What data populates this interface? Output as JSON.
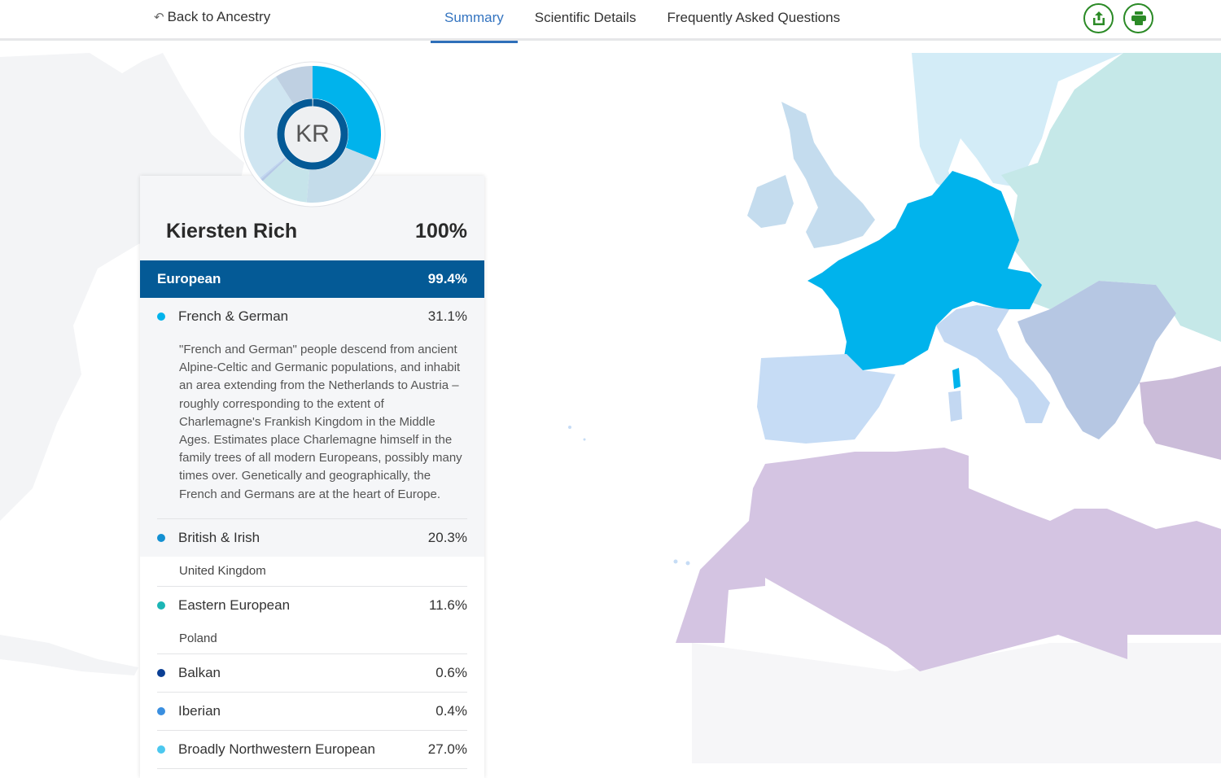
{
  "nav": {
    "back_label": "Back to Ancestry",
    "back_icon": "back-arrow-icon",
    "tabs": [
      {
        "label": "Summary",
        "active": true
      },
      {
        "label": "Scientific Details",
        "active": false
      },
      {
        "label": "Frequently Asked Questions",
        "active": false
      }
    ],
    "actions": [
      {
        "name": "share",
        "icon": "share-upload-icon"
      },
      {
        "name": "print",
        "icon": "printer-icon"
      }
    ],
    "accent_color": "#3474c0",
    "action_color": "#2b8a26"
  },
  "profile": {
    "initials": "KR",
    "name": "Kiersten Rich",
    "total": "100%"
  },
  "composition": {
    "group": {
      "label": "European",
      "percent": "99.4%",
      "color": "#045a96"
    },
    "populations": [
      {
        "label": "French & German",
        "percent": "31.1%",
        "color": "#00b3ec",
        "description": "\"French and German\" people descend from ancient Alpine-Celtic and Germanic populations, and inhabit an area extending from the Netherlands to Austria – roughly corresponding to the extent of Charlemagne's Frankish Kingdom in the Middle Ages. Estimates place Charlemagne himself in the family trees of all modern Europeans, possibly many times over. Genetically and geographically, the French and Germans are at the heart of Europe."
      },
      {
        "label": "British & Irish",
        "percent": "20.3%",
        "color": "#1390d2",
        "sublocation": "United Kingdom"
      },
      {
        "label": "Eastern European",
        "percent": "11.6%",
        "color": "#1bb5b5",
        "sublocation": "Poland"
      },
      {
        "label": "Balkan",
        "percent": "0.6%",
        "color": "#0b3f94"
      },
      {
        "label": "Iberian",
        "percent": "0.4%",
        "color": "#3a8fe0"
      },
      {
        "label": "Broadly Northwestern European",
        "percent": "27.0%",
        "color": "#4cc8ef"
      }
    ]
  },
  "donut_chart": {
    "segments": [
      {
        "label": "French & German",
        "value": 31.1,
        "color": "#00b3ec"
      },
      {
        "label": "British & Irish",
        "value": 20.3,
        "color": "#c4dcea"
      },
      {
        "label": "Eastern European",
        "value": 11.6,
        "color": "#c6e4ea"
      },
      {
        "label": "Balkan",
        "value": 0.6,
        "color": "#b5c8e6"
      },
      {
        "label": "Iberian",
        "value": 0.4,
        "color": "#c0d6f0"
      },
      {
        "label": "Broadly Northwestern European",
        "value": 27.0,
        "color": "#cfe5f1"
      },
      {
        "label": "Other",
        "value": 9.0,
        "color": "#bfd0e2"
      }
    ],
    "inner_ring_value": 99.4,
    "inner_ring_color": "#045a96"
  },
  "map": {
    "regions": [
      {
        "name": "French & German",
        "color": "#00b3ec"
      },
      {
        "name": "British & Irish",
        "color": "#c4dcee"
      },
      {
        "name": "Scandinavian",
        "color": "#d3ecf7"
      },
      {
        "name": "Eastern European",
        "color": "#c5e8e8"
      },
      {
        "name": "Balkan",
        "color": "#b6c7e3"
      },
      {
        "name": "Italian",
        "color": "#c3d8f2"
      },
      {
        "name": "Iberian",
        "color": "#c6dcf5"
      },
      {
        "name": "North African",
        "color": "#d4c4e2"
      },
      {
        "name": "Western Asian",
        "color": "#cbbcd9"
      }
    ]
  }
}
